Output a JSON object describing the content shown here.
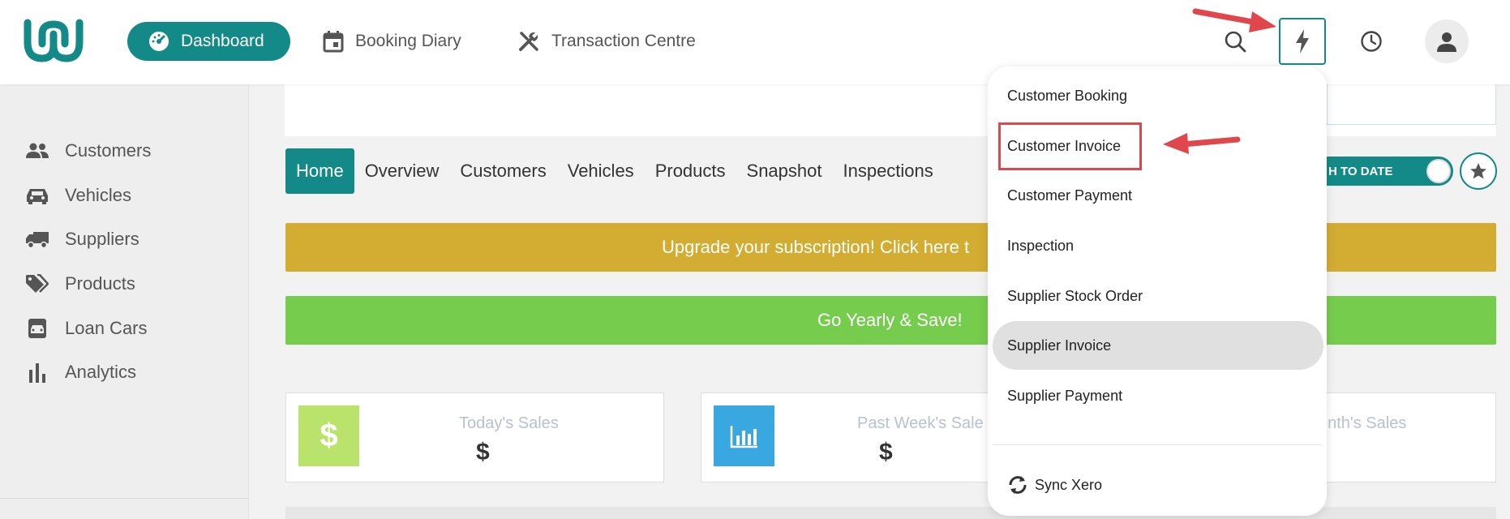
{
  "header": {
    "nav": {
      "dashboard": "Dashboard",
      "booking_diary": "Booking Diary",
      "transaction_centre": "Transaction Centre"
    }
  },
  "sidebar": {
    "items": [
      {
        "label": "Customers",
        "icon": "people-icon"
      },
      {
        "label": "Vehicles",
        "icon": "car-icon"
      },
      {
        "label": "Suppliers",
        "icon": "truck-icon"
      },
      {
        "label": "Products",
        "icon": "tags-icon"
      },
      {
        "label": "Loan Cars",
        "icon": "loan-car-icon"
      },
      {
        "label": "Analytics",
        "icon": "bar-chart-icon"
      }
    ]
  },
  "tabs": [
    "Home",
    "Overview",
    "Customers",
    "Vehicles",
    "Products",
    "Snapshot",
    "Inspections"
  ],
  "toggle": {
    "label": "H TO DATE"
  },
  "banners": {
    "upgrade": "Upgrade your subscription! Click here t",
    "yearly": "Go Yearly & Save!"
  },
  "stats": [
    {
      "label": "Today's Sales",
      "value": "$",
      "color": "#b9e36a"
    },
    {
      "label": "Past Week's Sale",
      "value": "$",
      "color": "#3aa8e0"
    },
    {
      "label": "onth's Sales",
      "value": ""
    }
  ],
  "dropdown": {
    "items": [
      "Customer Booking",
      "Customer Invoice",
      "Customer Payment",
      "Inspection",
      "Supplier Stock Order",
      "Supplier Invoice",
      "Supplier Payment"
    ],
    "sync": "Sync Xero"
  },
  "colors": {
    "brand": "#138a87",
    "upgrade_banner": "#d3ac32",
    "yearly_banner": "#76cc4d",
    "annotation": "#e0474c"
  }
}
